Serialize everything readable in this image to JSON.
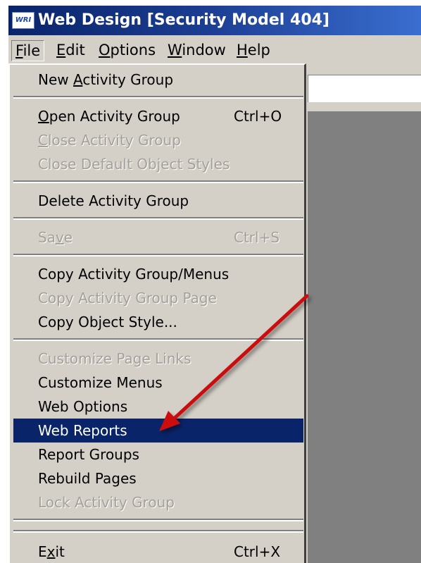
{
  "window": {
    "app_icon_text": "WRI",
    "title": "Web Design [Security Model 404]"
  },
  "menubar": {
    "file": {
      "m": "F",
      "rest": "ile"
    },
    "edit": {
      "m": "E",
      "rest": "dit"
    },
    "options": {
      "m": "O",
      "rest": "ptions"
    },
    "window": {
      "m": "W",
      "rest": "indow"
    },
    "help": {
      "m": "H",
      "rest": "elp"
    }
  },
  "file_menu": {
    "new_activity_group": {
      "pre": "New ",
      "m": "A",
      "post": "ctivity Group"
    },
    "open_activity_group": {
      "pre": "",
      "m": "O",
      "post": "pen Activity Group",
      "shortcut": "Ctrl+O"
    },
    "close_activity_group": {
      "pre": "",
      "m": "C",
      "post": "lose Activity Group"
    },
    "close_default_object_styles": {
      "label": "Close Default Object Styles"
    },
    "delete_activity_group": {
      "label": "Delete Activity Group"
    },
    "save": {
      "pre": "Sa",
      "m": "v",
      "post": "e",
      "shortcut": "Ctrl+S"
    },
    "copy_activity_group_menus": {
      "label": "Copy Activity Group/Menus"
    },
    "copy_activity_group_page": {
      "label": "Copy Activity Group Page"
    },
    "copy_object_style": {
      "label": "Copy Object Style..."
    },
    "customize_page_links": {
      "label": "Customize Page Links"
    },
    "customize_menus": {
      "label": "Customize Menus"
    },
    "web_options": {
      "label": "Web Options"
    },
    "web_reports": {
      "label": "Web Reports"
    },
    "report_groups": {
      "label": "Report Groups"
    },
    "rebuild_pages": {
      "label": "Rebuild Pages"
    },
    "lock_activity_group": {
      "label": "Lock Activity Group"
    },
    "exit": {
      "pre": "E",
      "m": "x",
      "post": "it",
      "shortcut": "Ctrl+X"
    }
  },
  "highlighted_item": "Web Reports",
  "colors": {
    "highlight": "#0a246a",
    "titlebar_start": "#0a246a",
    "titlebar_end": "#3a6ed0",
    "menu_face": "#d4d0c8",
    "disabled_text": "#a4a09a",
    "annotation_arrow": "#cc1111"
  }
}
